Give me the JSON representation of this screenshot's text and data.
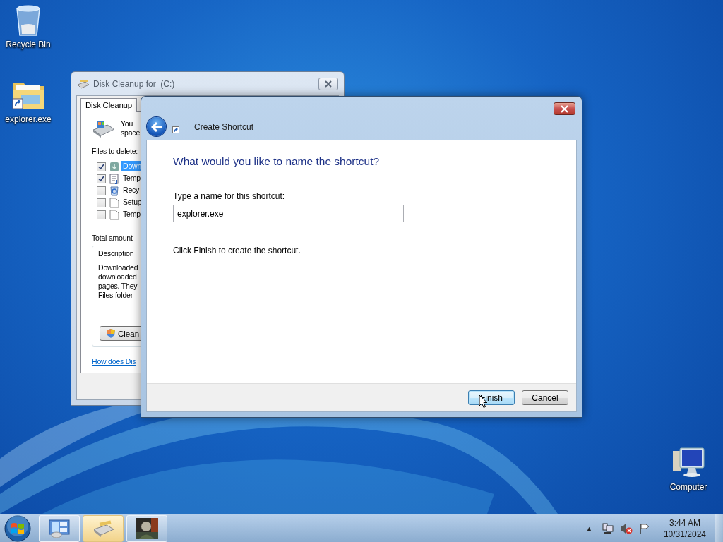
{
  "desktop": {
    "icons": [
      {
        "kind": "recycle-bin",
        "label": "Recycle Bin"
      },
      {
        "kind": "folder-shortcut",
        "label": "explorer.exe"
      },
      {
        "kind": "computer",
        "label": "Computer"
      }
    ]
  },
  "disk_cleanup_window": {
    "title": "Disk Cleanup for  (C:)",
    "tabs": [
      {
        "label": "Disk Cleanup",
        "selected": true
      }
    ],
    "intro_lines": [
      "You",
      "space"
    ],
    "files_label": "Files to delete:",
    "files": [
      {
        "kind": "download",
        "name": "Down",
        "checked": true,
        "selected": true
      },
      {
        "kind": "document",
        "name": "Temp",
        "checked": true,
        "selected": false
      },
      {
        "kind": "recycle",
        "name": "Recy",
        "checked": false,
        "selected": false
      },
      {
        "kind": "blank",
        "name": "Setup",
        "checked": false,
        "selected": false
      },
      {
        "kind": "blank",
        "name": "Temp",
        "checked": false,
        "selected": false
      }
    ],
    "total_label": "Total amount",
    "description_label": "Description",
    "description_lines": [
      "Downloaded",
      "downloaded",
      "pages. They",
      "Files folder"
    ],
    "clean_button": "Clean",
    "help_link": "How does Dis"
  },
  "dialog": {
    "title": "Create Shortcut",
    "heading": "What would you like to name the shortcut?",
    "field_label": "Type a name for this shortcut:",
    "field_value": "explorer.exe",
    "hint": "Click Finish to create the shortcut.",
    "buttons": [
      {
        "label": "Finish",
        "default": true
      },
      {
        "label": "Cancel",
        "default": false
      }
    ]
  },
  "taskbar": {
    "buttons": [
      {
        "kind": "control-panel",
        "active": false
      },
      {
        "kind": "disk-cleanup",
        "active": true
      },
      {
        "kind": "picture",
        "active": false
      }
    ],
    "tray_arrow": "▲",
    "time": "3:44 AM",
    "date": "10/31/2024"
  }
}
